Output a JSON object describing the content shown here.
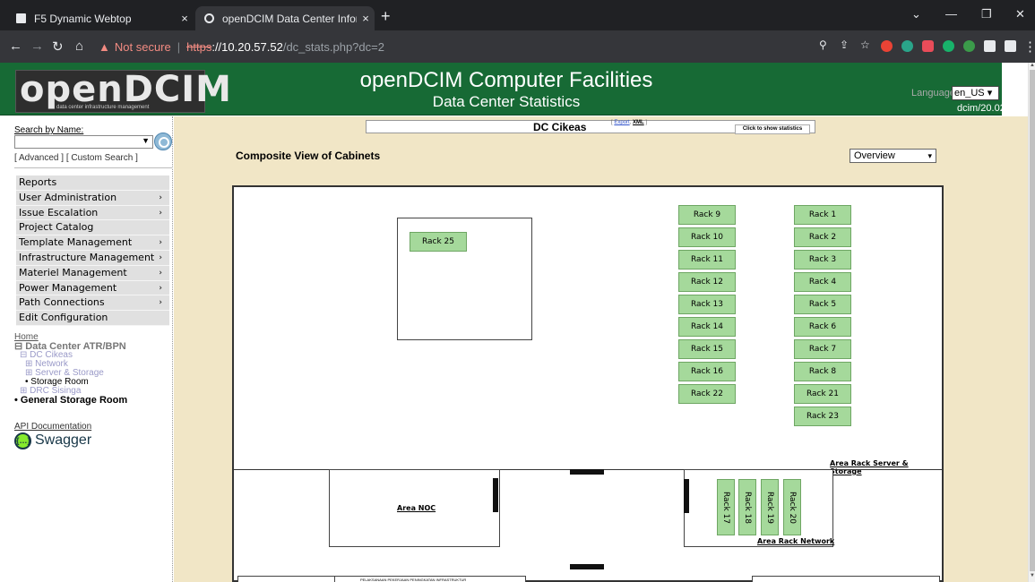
{
  "browser": {
    "tabs": [
      {
        "title": "F5 Dynamic Webtop",
        "close": "×"
      },
      {
        "title": "openDCIM Data Center Informati",
        "close": "×"
      }
    ],
    "new_tab": "+",
    "url_warning": "Not secure",
    "url_scheme": "https",
    "url_host": "://10.20.57.52",
    "url_path": "/dc_stats.php?dc=2",
    "controls": {
      "minimize": "—",
      "restore": "❐",
      "close": "✕",
      "chevron": "⌄"
    }
  },
  "header": {
    "logo": "openDCIM",
    "logo_tagline": "data center infrastructure management",
    "title": "openDCIM Computer Facilities",
    "subtitle": "Data Center Statistics",
    "language_label": "Language",
    "language_value": "en_US ▾",
    "version": "dcim/20.02"
  },
  "sidebar": {
    "search_label": "Search by Name:",
    "search_links": "[ Advanced ] [ Custom Search ]",
    "menu": [
      {
        "label": "Reports",
        "chev": ""
      },
      {
        "label": "User Administration",
        "chev": "›"
      },
      {
        "label": "Issue Escalation",
        "chev": "›"
      },
      {
        "label": "Project Catalog",
        "chev": ""
      },
      {
        "label": "Template Management",
        "chev": "›"
      },
      {
        "label": "Infrastructure Management",
        "chev": "›"
      },
      {
        "label": "Materiel Management",
        "chev": "›"
      },
      {
        "label": "Power Management",
        "chev": "›"
      },
      {
        "label": "Path Connections",
        "chev": "›"
      },
      {
        "label": "Edit Configuration",
        "chev": ""
      }
    ],
    "tree": {
      "home": "Home",
      "dc": "⊟ Data Center ATR/BPN",
      "cikeas": "⊟ DC Cikeas",
      "network": "⊞ Network",
      "server": "⊞ Server & Storage",
      "storage": "• Storage Room",
      "drc": "⊞ DRC Sisinga",
      "general": "• General Storage Room"
    },
    "api_doc": "API Documentation",
    "swagger": "Swagger",
    "swagger_icon": "{…}"
  },
  "main": {
    "dc_name": "DC Cikeas",
    "export_link": "Export",
    "xml_link": "XML",
    "stats_button": "Click to show statistics",
    "composite_title": "Composite View of Cabinets",
    "view_value": "Overview",
    "area_server": "Area Rack Server & Storage",
    "area_noc": "Area NOC",
    "area_network": "Area Rack Network",
    "bottom_note": "PELAKSANAAN PEKERJAAN PENINGKATAN INFRASTRUKTUR",
    "racks": {
      "r25": "Rack 25",
      "col_a": [
        "Rack 9",
        "Rack 10",
        "Rack 11",
        "Rack 12",
        "Rack 13",
        "Rack 14",
        "Rack 15",
        "Rack 16",
        "Rack 22"
      ],
      "col_b": [
        "Rack 1",
        "Rack 2",
        "Rack 3",
        "Rack 4",
        "Rack 5",
        "Rack 6",
        "Rack 7",
        "Rack 8",
        "Rack 21",
        "Rack 23"
      ],
      "network": [
        "Rack 17",
        "Rack 18",
        "Rack 19",
        "Rack 20"
      ]
    }
  },
  "colors": {
    "header_green": "#176a35",
    "content_bg": "#f1e6c6",
    "rack_fill": "#a5d99b"
  }
}
